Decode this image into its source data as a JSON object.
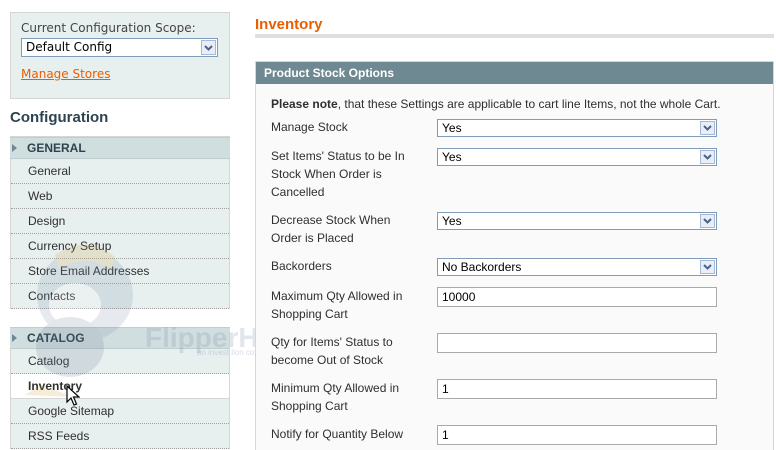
{
  "sidebar": {
    "scope_label": "Current Configuration Scope:",
    "scope_value": "Default Config",
    "manage_stores": "Manage Stores",
    "config_title": "Configuration",
    "general_section": "GENERAL",
    "general_items": [
      "General",
      "Web",
      "Design",
      "Currency Setup",
      "Store Email Addresses",
      "Contacts"
    ],
    "catalog_section": "CATALOG",
    "catalog_items": [
      "Catalog",
      "Inventory",
      "Google Sitemap",
      "RSS Feeds"
    ]
  },
  "watermark": {
    "brand": "FlipperHost",
    "tagline": "an invest lion company"
  },
  "main": {
    "title": "Inventory",
    "fieldset_title": "Product Stock Options",
    "note_bold": "Please note",
    "note_rest": ", that these Settings are applicable to cart line Items, not the whole Cart.",
    "fields": [
      {
        "label": "Manage Stock",
        "value": "Yes"
      },
      {
        "label": "Set Items' Status to be In Stock When Order is Cancelled",
        "value": "Yes"
      },
      {
        "label": "Decrease Stock When Order is Placed",
        "value": "Yes"
      },
      {
        "label": "Backorders",
        "value": "No Backorders"
      },
      {
        "label": "Maximum Qty Allowed in Shopping Cart",
        "value": "10000"
      },
      {
        "label": "Qty for Items' Status to become Out of Stock",
        "value": ""
      },
      {
        "label": "Minimum Qty Allowed in Shopping Cart",
        "value": "1"
      },
      {
        "label": "Notify for Quantity Below",
        "value": "1"
      }
    ]
  },
  "colors": {
    "accent": "#eb5e00",
    "header": "#6f8992",
    "nav_bg": "#e7efef"
  }
}
